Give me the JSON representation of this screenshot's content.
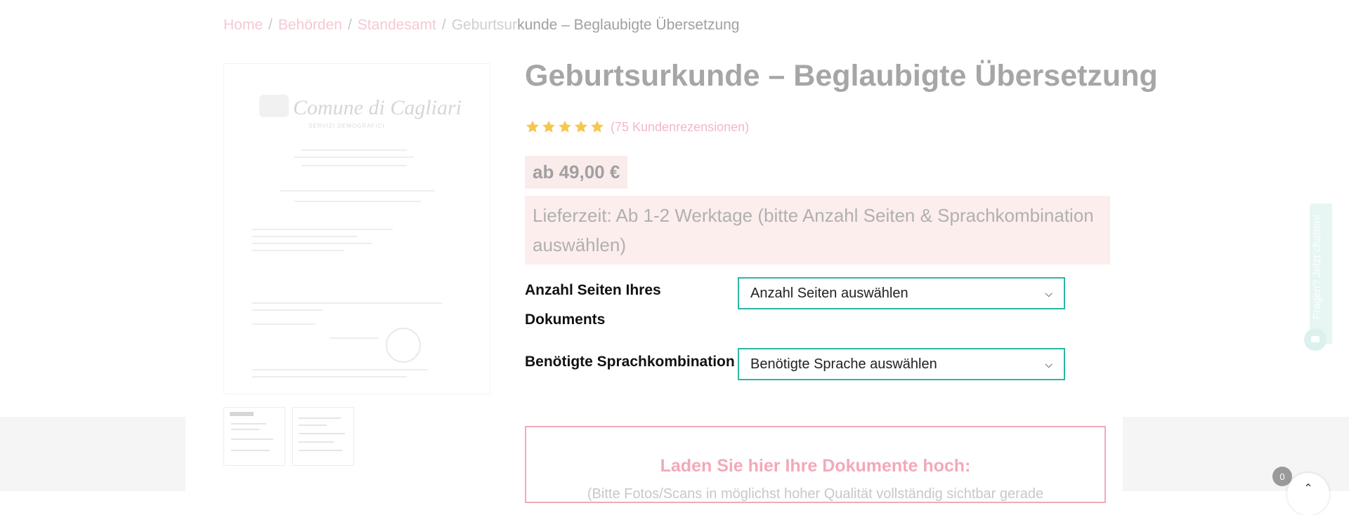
{
  "breadcrumb": {
    "home": "Home",
    "behoerden": "Behörden",
    "standesamt": "Standesamt",
    "current_part1": "Geburtsur",
    "current_part2": "kunde – Beglaubigte Übersetzung",
    "separator": "/"
  },
  "document_image": {
    "title": "Comune di Cagliari",
    "subtitle": "SERVIZI DEMOGRAFICI"
  },
  "product": {
    "title": "Geburtsurkunde – Beglaubigte Übersetzung",
    "rating": {
      "stars": 5,
      "reviews_link": "(75 Kundenrezensionen)"
    },
    "price": "ab 49,00 €",
    "delivery": "Lieferzeit: Ab 1-2 Werktage (bitte Anzahl Seiten & Sprachkombination auswählen)"
  },
  "form": {
    "pages_label_line1": "Anzahl Seiten Ihres",
    "pages_label_line2": "Dokuments",
    "pages_select": "Anzahl Seiten auswählen",
    "language_label": "Benötigte Sprachkombination",
    "language_select": "Benötigte Sprache auswählen"
  },
  "upload": {
    "title": "Laden Sie hier Ihre Dokumente hoch:",
    "text": "(Bitte Fotos/Scans in möglichst hoher Qualität vollständig sichtbar gerade"
  },
  "chat": {
    "label": "Fragen? Jetzt chatten!"
  },
  "cart": {
    "count": "0"
  },
  "colors": {
    "accent_teal": "#2bb6a3",
    "accent_pink": "#f3a9b8",
    "star_gold": "#f5c84c",
    "price_bg": "#fbecec"
  }
}
